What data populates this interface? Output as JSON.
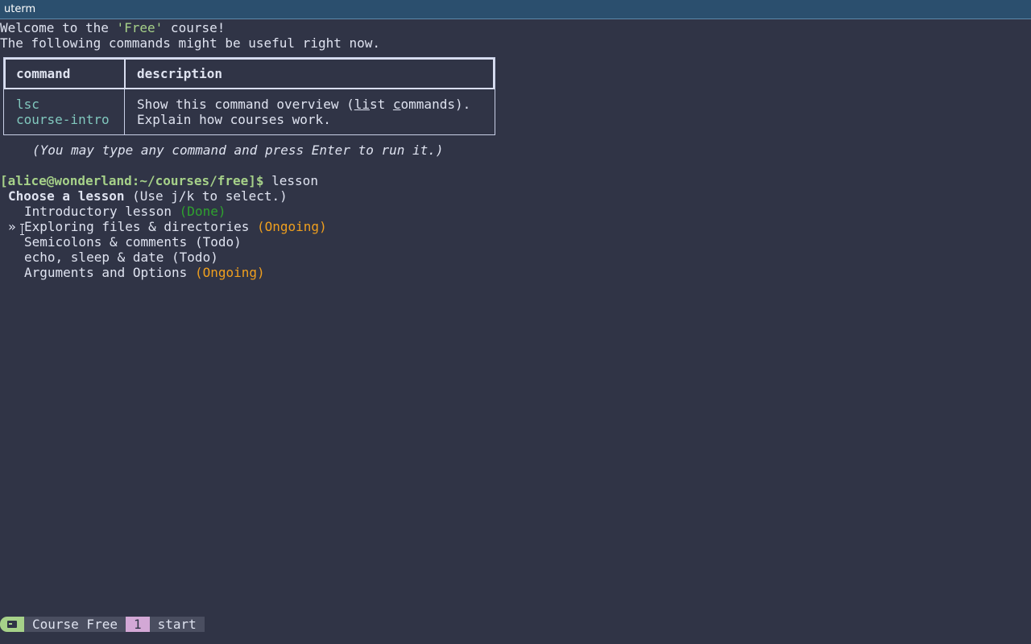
{
  "window": {
    "title": "uterm"
  },
  "welcome": {
    "prefix": "Welcome to the ",
    "course_name": "'Free'",
    "suffix": " course!",
    "line2": "The following commands might be useful right now."
  },
  "commands_table": {
    "headers": [
      "command",
      "description"
    ],
    "rows": [
      {
        "command": "lsc",
        "description_parts": [
          "Show this command overview (",
          "li",
          "st ",
          "c",
          "ommands)."
        ]
      },
      {
        "command": "course-intro",
        "description_parts": [
          "Explain how courses work."
        ]
      }
    ],
    "hint": "(You may type any command and press Enter to run it.)"
  },
  "prompt": {
    "text": "[alice@wonderland:~/courses/free]$",
    "command": " lesson"
  },
  "lesson_picker": {
    "question": "Choose a lesson",
    "hint": " (Use j/k to select.)",
    "selector": "»",
    "lessons": [
      {
        "title": "Introductory lesson",
        "status": "(Done)",
        "status_kind": "done",
        "selected": false
      },
      {
        "title": "Exploring files & directories",
        "status": "(Ongoing)",
        "status_kind": "ongoing",
        "selected": true
      },
      {
        "title": "Semicolons & comments",
        "status": "(Todo)",
        "status_kind": "todo",
        "selected": false
      },
      {
        "title": "echo, sleep & date",
        "status": "(Todo)",
        "status_kind": "todo",
        "selected": false
      },
      {
        "title": "Arguments and Options",
        "status": "(Ongoing)",
        "status_kind": "ongoing",
        "selected": false
      }
    ]
  },
  "status_bar": {
    "icon": "terminal-icon",
    "session": "Course Free",
    "window_number": "1",
    "window_name": "start"
  },
  "colors": {
    "background": "#303446",
    "foreground": "#dfe3f0",
    "accent_green": "#a6d189",
    "teal": "#81c8be",
    "ongoing": "#ef9f1e",
    "done": "#2fa22f",
    "titlebar": "#2b4f6e",
    "window_number_bg": "#d3a8d6"
  }
}
